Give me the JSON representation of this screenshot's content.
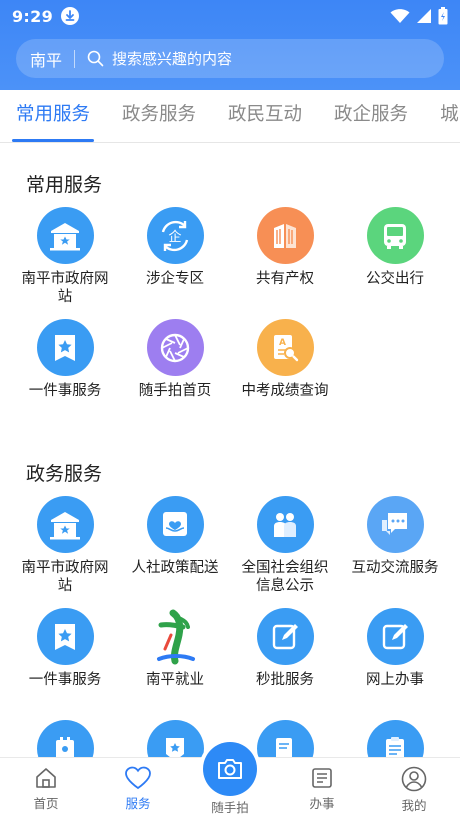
{
  "status_bar": {
    "time": "9:29"
  },
  "search": {
    "city": "南平",
    "placeholder": "搜索感兴趣的内容"
  },
  "tabs": [
    {
      "label": "常用服务",
      "active": true
    },
    {
      "label": "政务服务",
      "active": false
    },
    {
      "label": "政民互动",
      "active": false
    },
    {
      "label": "政企服务",
      "active": false
    },
    {
      "label": "城",
      "active": false
    }
  ],
  "sections": [
    {
      "title": "常用服务",
      "items": [
        {
          "label": "南平市政府网站",
          "icon": "government-building-icon"
        },
        {
          "label": "涉企专区",
          "icon": "enterprise-icon"
        },
        {
          "label": "共有产权",
          "icon": "building-icon"
        },
        {
          "label": "公交出行",
          "icon": "bus-icon"
        },
        {
          "label": "一件事服务",
          "icon": "star-bookmark-icon"
        },
        {
          "label": "随手拍首页",
          "icon": "aperture-icon"
        },
        {
          "label": "中考成绩查询",
          "icon": "exam-search-icon"
        }
      ]
    },
    {
      "title": "政务服务",
      "items": [
        {
          "label": "南平市政府网站",
          "icon": "government-building-icon"
        },
        {
          "label": "人社政策配送",
          "icon": "hand-heart-icon"
        },
        {
          "label": "全国社会组织信息公示",
          "icon": "people-icon"
        },
        {
          "label": "互动交流服务",
          "icon": "chat-icon"
        },
        {
          "label": "一件事服务",
          "icon": "star-bookmark-icon"
        },
        {
          "label": "南平就业",
          "icon": "nanping-employment-logo"
        },
        {
          "label": "秒批服务",
          "icon": "edit-icon"
        },
        {
          "label": "网上办事",
          "icon": "edit-icon"
        }
      ]
    }
  ],
  "bottom_nav": [
    {
      "label": "首页",
      "icon": "home-icon",
      "active": false
    },
    {
      "label": "服务",
      "icon": "heart-icon",
      "active": true
    },
    {
      "label": "随手拍",
      "icon": "camera-icon",
      "active": false
    },
    {
      "label": "办事",
      "icon": "document-icon",
      "active": false
    },
    {
      "label": "我的",
      "icon": "user-icon",
      "active": false
    }
  ],
  "colors": {
    "brand": "#2d7af4",
    "header": "#3d86f6",
    "icon_blue": "#3a9cf3",
    "icon_orange": "#f78f55",
    "icon_green": "#5bd57d",
    "icon_purple": "#9d7ef0",
    "icon_yellow": "#f8b14c"
  }
}
